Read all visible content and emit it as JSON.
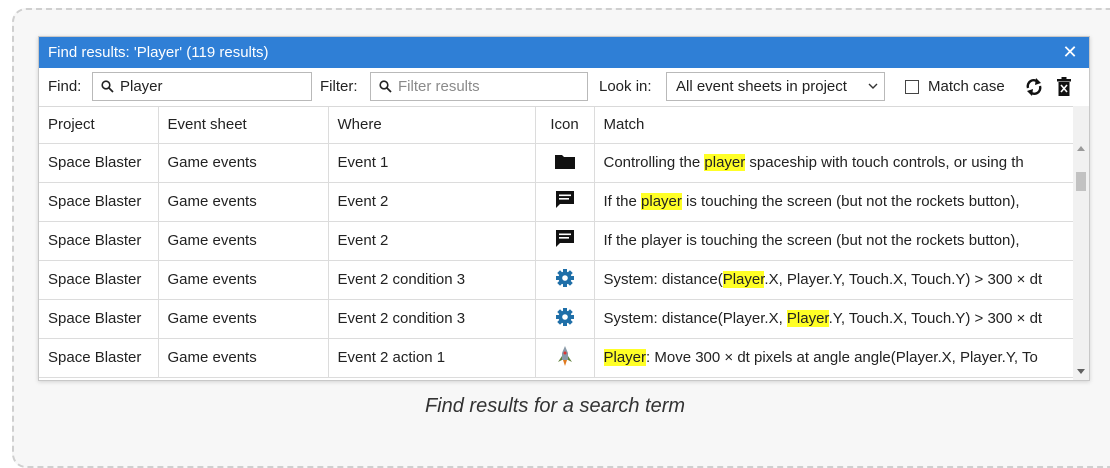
{
  "window": {
    "title": "Find results: 'Player' (119 results)",
    "close_glyph": "✕"
  },
  "toolbar": {
    "find_label": "Find:",
    "find_value": "Player",
    "filter_label": "Filter:",
    "filter_placeholder": "Filter results",
    "lookin_label": "Look in:",
    "lookin_value": "All event sheets in project",
    "matchcase_label": "Match case",
    "matchcase_checked": false,
    "refresh_icon": "refresh-icon",
    "clear_icon": "trash-icon"
  },
  "table": {
    "columns": [
      "Project",
      "Event sheet",
      "Where",
      "Icon",
      "Match"
    ],
    "rows": [
      {
        "project": "Space Blaster",
        "sheet": "Game events",
        "where": "Event 1",
        "icon": "folder-icon",
        "match_pre": "Controlling the ",
        "match_hl": "player",
        "match_post": " spaceship with touch controls, or using th"
      },
      {
        "project": "Space Blaster",
        "sheet": "Game events",
        "where": "Event 2",
        "icon": "comment-icon",
        "match_pre": "If the ",
        "match_hl": "player",
        "match_post": " is touching the screen (but not the rockets button),"
      },
      {
        "project": "Space Blaster",
        "sheet": "Game events",
        "where": "Event 2",
        "icon": "comment-icon",
        "match_pre": "If the player is touching the screen (but not the rockets button),",
        "match_hl": "",
        "match_post": ""
      },
      {
        "project": "Space Blaster",
        "sheet": "Game events",
        "where": "Event 2 condition 3",
        "icon": "gear-icon",
        "match_pre": "System: distance(",
        "match_hl": "Player",
        "match_post": ".X, Player.Y, Touch.X, Touch.Y) > 300 × dt"
      },
      {
        "project": "Space Blaster",
        "sheet": "Game events",
        "where": "Event 2 condition 3",
        "icon": "gear-icon",
        "match_pre": "System: distance(Player.X, ",
        "match_hl": "Player",
        "match_post": ".Y, Touch.X, Touch.Y) > 300 × dt"
      },
      {
        "project": "Space Blaster",
        "sheet": "Game events",
        "where": "Event 2 action 1",
        "icon": "rocket-icon",
        "match_pre": "",
        "match_hl": "Player",
        "match_post": ": Move 300 × dt pixels at angle angle(Player.X, Player.Y, To"
      }
    ]
  },
  "caption": "Find results for a search term",
  "colors": {
    "titlebar": "#2f7fd6",
    "highlight": "#ffff26",
    "gear": "#1f6fa8"
  }
}
